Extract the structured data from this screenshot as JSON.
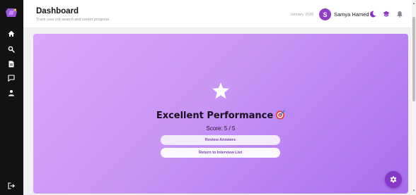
{
  "header": {
    "title": "Dashboard",
    "subtitle": "Track your job search and career progress",
    "date": "January 2026",
    "user": {
      "initial": "S",
      "name": "Samya Hamed"
    },
    "icons": [
      "moon-icon",
      "cap-icon",
      "bell-icon"
    ]
  },
  "sidebar": {
    "logo": "logo-icon",
    "items": [
      {
        "name": "home",
        "icon": "home-icon"
      },
      {
        "name": "search",
        "icon": "search-icon"
      },
      {
        "name": "documents",
        "icon": "document-icon"
      },
      {
        "name": "messages",
        "icon": "chat-icon"
      },
      {
        "name": "profile",
        "icon": "user-icon"
      }
    ],
    "footer_icon": "logout-icon"
  },
  "result": {
    "title": "Excellent Performance",
    "score": "Score: 5 / 5",
    "review_button": "Review Answers",
    "return_button": "Return to Interview List"
  },
  "fab": {
    "icon": "settings-icon"
  },
  "colors": {
    "accent": "#8637c8",
    "card_gradient_start": "#dba6fb",
    "card_gradient_end": "#a86eee",
    "sidebar_bg": "#121212"
  }
}
